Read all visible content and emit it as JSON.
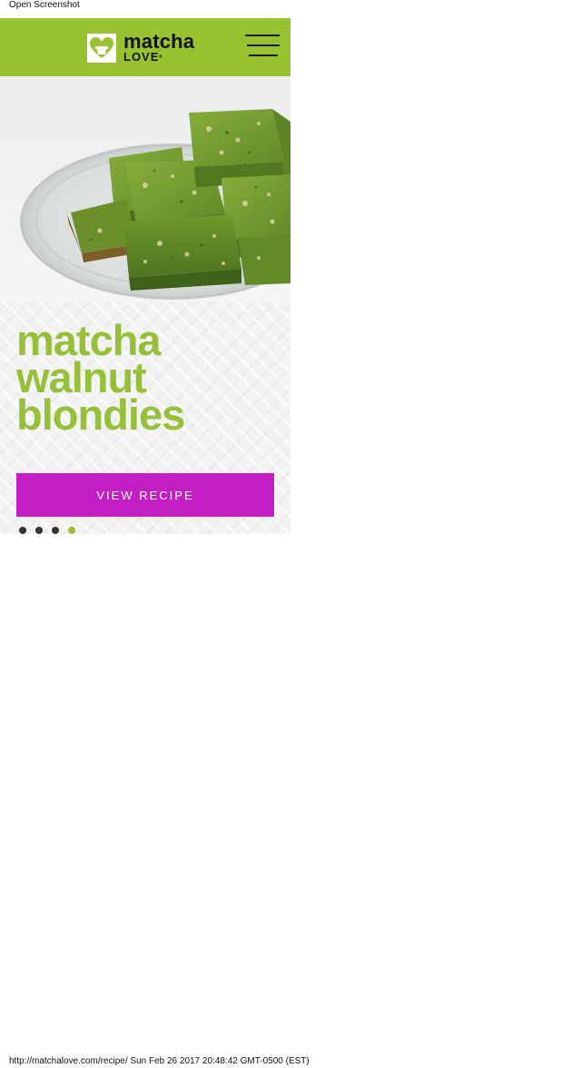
{
  "print": {
    "header": "Open Screenshot",
    "footer": "http://matchalove.com/recipe/ Sun Feb 26 2017 20:48:42 GMT-0500 (EST)"
  },
  "brand": {
    "name": "matcha",
    "sub": "LOVE",
    "trademark": "®",
    "bar_color": "#99c231"
  },
  "nav": {
    "menu_icon": "hamburger-menu-icon"
  },
  "hero": {
    "image": "matcha walnut blondies on glass plate",
    "title_lines": [
      "matcha",
      "walnut",
      "blondies"
    ],
    "title_color": "#96c03a",
    "button_label": "VIEW RECIPE",
    "button_color": "#c21ec3",
    "slides": 4,
    "active_slide": 4
  }
}
